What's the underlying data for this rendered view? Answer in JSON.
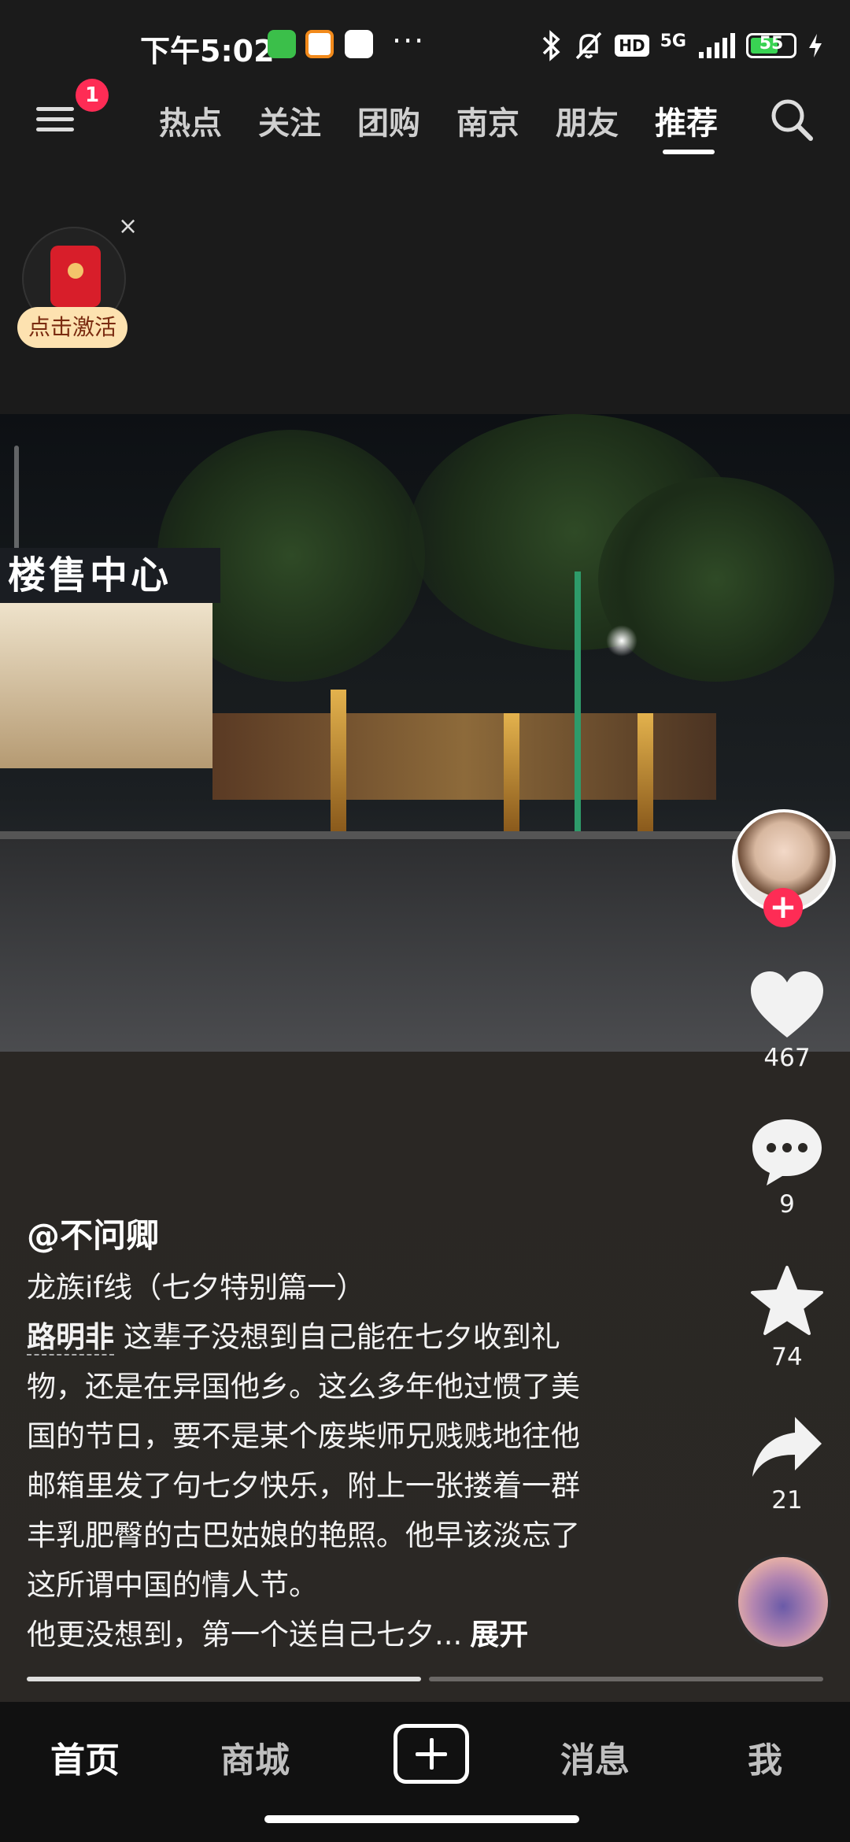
{
  "status_bar": {
    "time": "下午5:02",
    "network": "5G",
    "hd": "HD",
    "battery": "55",
    "more": "···"
  },
  "top_nav": {
    "notification_badge": "1",
    "tabs": [
      "热点",
      "关注",
      "团购",
      "南京",
      "朋友",
      "推荐"
    ],
    "active_tab": "推荐"
  },
  "red_packet": {
    "label": "点击激活",
    "close": "×"
  },
  "video": {
    "store_sign": "楼售中心"
  },
  "right_rail": {
    "likes": "467",
    "comments": "9",
    "favorites": "74",
    "shares": "21",
    "follow": "+"
  },
  "caption": {
    "author": "@不问卿",
    "title": "龙族if线（七夕特别篇一）",
    "mention": "路明非",
    "line1_rest": " 这辈子没想到自己能在七夕收到礼",
    "line2": "物，还是在异国他乡。这么多年他过惯了美",
    "line3": "国的节日，要不是某个废柴师兄贱贱地往他",
    "line4": "邮箱里发了句七夕快乐，附上一张搂着一群",
    "line5": "丰乳肥臀的古巴姑娘的艳照。他早该淡忘了",
    "line6": "这所谓中国的情人节。",
    "line7": "他更没想到，第一个送自己七夕...",
    "expand": "展开"
  },
  "progress": {
    "segments": 2,
    "current": 1
  },
  "bottom_tabs": {
    "home": "首页",
    "mall": "商城",
    "messages": "消息",
    "me": "我"
  },
  "colors": {
    "accent": "#fe2c55",
    "background": "#161616"
  }
}
